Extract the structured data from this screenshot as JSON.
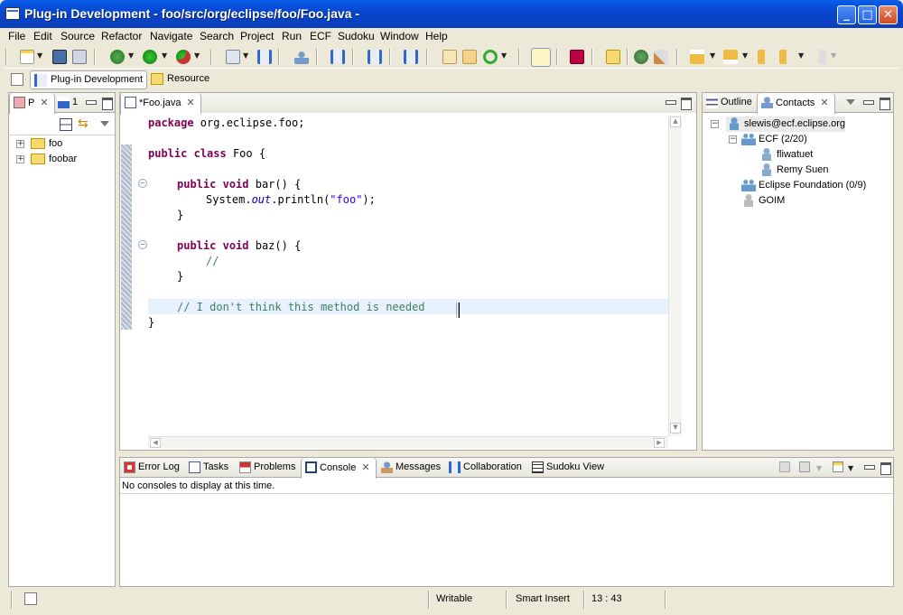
{
  "window": {
    "title": "Plug-in Development - foo/src/org/eclipse/foo/Foo.java -"
  },
  "menu": [
    "File",
    "Edit",
    "Source",
    "Refactor",
    "Navigate",
    "Search",
    "Project",
    "Run",
    "ECF",
    "Sudoku",
    "Window",
    "Help"
  ],
  "perspectives": {
    "plugin_dev": "Plug-in Development",
    "resource": "Resource"
  },
  "left_panel": {
    "tabs": {
      "packages": "P",
      "second": "1"
    },
    "projects": [
      "foo",
      "foobar"
    ]
  },
  "editor": {
    "tab_label": "*Foo.java",
    "lines": {
      "l1_kw": "package",
      "l1_rest": " org.eclipse.foo;",
      "l3_kw1": "public",
      "l3_kw2": "class",
      "l3_rest": " Foo {",
      "l5_kw1": "public",
      "l5_kw2": "void",
      "l5_rest": " bar() {",
      "l6_a": "System.",
      "l6_field": "out",
      "l6_b": ".println(",
      "l6_str": "\"foo\"",
      "l6_c": ");",
      "l7": "}",
      "l9_kw1": "public",
      "l9_kw2": "void",
      "l9_rest": " baz() {",
      "l10_cm": "//",
      "l11": "}",
      "l13_cm": "// I don't think this method is needed",
      "l14": "}"
    }
  },
  "right_panel": {
    "tabs": {
      "outline": "Outline",
      "contacts": "Contacts"
    },
    "account": "slewis@ecf.eclipse.org",
    "groups": [
      {
        "name": "ECF (2/20)",
        "members": [
          "fliwatuet",
          "Remy Suen"
        ]
      },
      {
        "name": "Eclipse Foundation (0/9)",
        "members": []
      },
      {
        "name": "GOIM",
        "members": []
      }
    ]
  },
  "bottom_panel": {
    "tabs": [
      "Error Log",
      "Tasks",
      "Problems",
      "Console",
      "Messages",
      "Collaboration",
      "Sudoku View"
    ],
    "active_tab": "Console",
    "message": "No consoles to display at this time."
  },
  "statusbar": {
    "writable": "Writable",
    "insert_mode": "Smart Insert",
    "position": "13 : 43"
  }
}
